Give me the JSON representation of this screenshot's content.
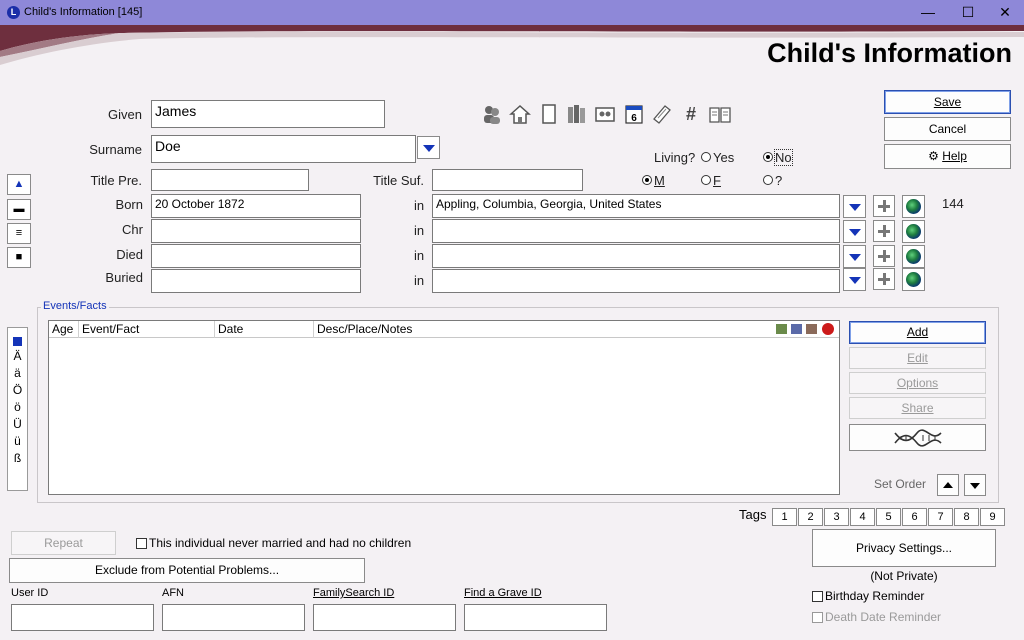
{
  "window": {
    "title": "Child's Information  [145]",
    "app_icon": "L",
    "minimize": "—",
    "maximize": "☐",
    "close": "✕"
  },
  "page_title": "Child's Information",
  "toolbar_icons": [
    "people-icon",
    "house-icon",
    "note-icon",
    "books-icon",
    "picture-icon",
    "calendar-icon",
    "scroll-icon",
    "hash-icon",
    "book-icon"
  ],
  "calendar_icon_text": "6",
  "hash_icon_text": "#",
  "form": {
    "given_label": "Given",
    "given_value": "James",
    "surname_label": "Surname",
    "surname_value": "Doe",
    "title_pre_label": "Title Pre.",
    "title_pre_value": "",
    "title_suf_label": "Title Suf.",
    "title_suf_value": "",
    "in_label": "in",
    "events": [
      {
        "label": "Born",
        "date": "20 October 1872",
        "place": "Appling, Columbia, Georgia, United States"
      },
      {
        "label": "Chr",
        "date": "",
        "place": ""
      },
      {
        "label": "Died",
        "date": "",
        "place": ""
      },
      {
        "label": "Buried",
        "date": "",
        "place": ""
      }
    ],
    "born_count": "144"
  },
  "living": {
    "label": "Living?",
    "yes": "Yes",
    "no": "No",
    "selected": "No"
  },
  "sex": {
    "m": "M",
    "f": "F",
    "unknown": "?",
    "selected": "M"
  },
  "buttons": {
    "save": "Save",
    "cancel": "Cancel",
    "help": "Help",
    "add": "Add",
    "edit": "Edit",
    "options": "Options",
    "share": "Share",
    "repeat": "Repeat",
    "exclude": "Exclude from Potential Problems...",
    "privacy": "Privacy Settings..."
  },
  "side_buttons": [
    "▲",
    "▬",
    "≡",
    "■"
  ],
  "special_chars": [
    "Ä",
    "ä",
    "Ö",
    "ö",
    "Ü",
    "ü",
    "ß"
  ],
  "events_facts": {
    "group_label": "Events/Facts",
    "columns": [
      "Age",
      "Event/Fact",
      "Date",
      "Desc/Place/Notes"
    ],
    "rows": []
  },
  "set_order_label": "Set Order",
  "tags": {
    "label": "Tags",
    "items": [
      "1",
      "2",
      "3",
      "4",
      "5",
      "6",
      "7",
      "8",
      "9"
    ]
  },
  "never_married_label": "This individual never married and had no children",
  "privacy_status": "(Not Private)",
  "birthday_reminder_label": "Birthday Reminder",
  "death_reminder_label": "Death Date Reminder",
  "ids": {
    "user_id_label": "User ID",
    "afn_label": "AFN",
    "familysearch_label": "FamilySearch ID",
    "findagrave_label": "Find a Grave ID"
  },
  "colors": {
    "title_bar": "#8e88d8",
    "dropdown_arrow": "#1434b8",
    "background": "#f4f1f4"
  }
}
